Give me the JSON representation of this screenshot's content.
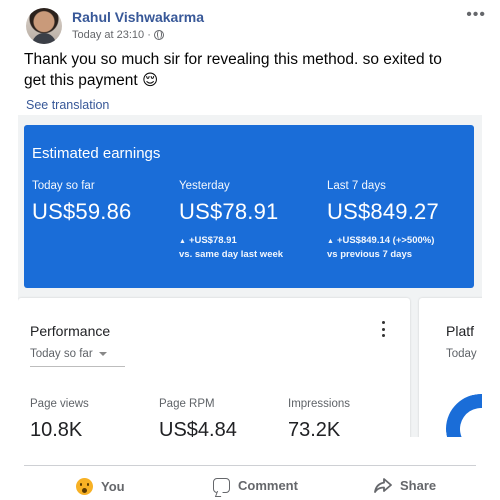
{
  "post": {
    "author": "Rahul Vishwakarma",
    "timestamp": "Today at 23:10 ·",
    "more_icon": "•••",
    "text": "Thank you so much sir for revealing this method. so exited to get this payment 😌",
    "see_translation": "See translation"
  },
  "earnings": {
    "title": "Estimated earnings",
    "columns": [
      {
        "label": "Today so far",
        "value": "US$59.86",
        "delta": "",
        "compare": ""
      },
      {
        "label": "Yesterday",
        "value": "US$78.91",
        "delta": "+US$78.91",
        "compare": "vs. same day last week"
      },
      {
        "label": "Last 7 days",
        "value": "US$849.27",
        "delta": "+US$849.14 (+>500%)",
        "compare": "vs previous 7 days"
      }
    ],
    "delta_icon": "▲",
    "accent_color": "#1a6dd8"
  },
  "performance": {
    "title": "Performance",
    "range": "Today so far",
    "metrics": [
      {
        "label": "Page views",
        "value": "10.8K"
      },
      {
        "label": "Page RPM",
        "value": "US$4.84"
      },
      {
        "label": "Impressions",
        "value": "73.2K"
      }
    ]
  },
  "platforms": {
    "title": "Platf",
    "range": "Today"
  },
  "actions": {
    "react_label": "You",
    "comment_label": "Comment",
    "share_label": "Share"
  }
}
